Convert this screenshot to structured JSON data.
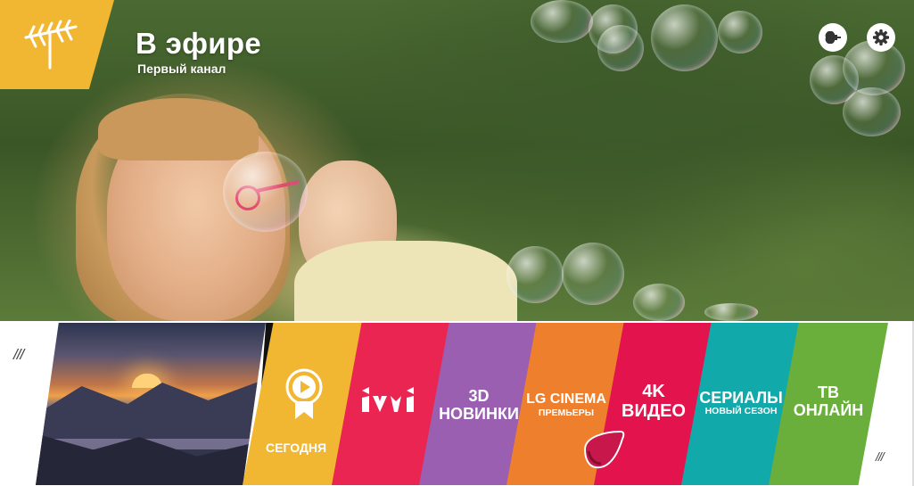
{
  "header": {
    "title": "В эфире",
    "channel": "Первый канал"
  },
  "colors": {
    "input_badge": "#f2b732",
    "segodnya": "#f2b732",
    "ivi": "#ea2552",
    "novinki": "#9a5fb0",
    "lg_cinema": "#ee7f2c",
    "video_4k": "#e3134d",
    "serialy": "#11a9aa",
    "tv_online": "#6aae3c"
  },
  "launcher": {
    "left_handle": "///",
    "right_handle": "///",
    "tiles": [
      {
        "id": "segodnya",
        "label": "СЕГОДНЯ",
        "icon": "play-badge-icon"
      },
      {
        "id": "ivi",
        "label": "ivi",
        "icon": "ivi-logo-icon"
      },
      {
        "id": "novinki",
        "line1": "3D",
        "line2": "НОВИНКИ"
      },
      {
        "id": "lg_cinema",
        "line1": "LG CINEMA",
        "line2": "ПРЕМЬЕРЫ"
      },
      {
        "id": "video_4k",
        "line1": "4K",
        "line2": "ВИДЕО"
      },
      {
        "id": "serialy",
        "line1": "СЕРИАЛЫ",
        "line2": "НОВЫЙ СЕЗОН"
      },
      {
        "id": "tv_online",
        "line1": "ТВ",
        "line2": "ОНЛАЙН"
      }
    ]
  },
  "icons": {
    "input": "antenna-icon",
    "external": "input-source-icon",
    "settings": "gear-icon",
    "pointer": "magic-remote-pointer-icon"
  }
}
